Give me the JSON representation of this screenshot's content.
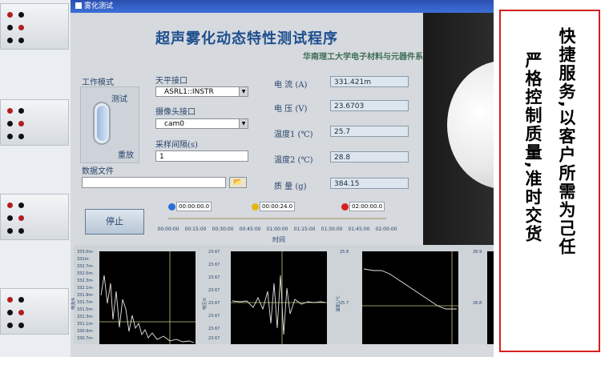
{
  "window": {
    "title": "雾化测试"
  },
  "header": {
    "title": "超声雾化动态特性测试程序",
    "subtitle": "华南理工大学电子材料与元器件系"
  },
  "mode": {
    "label": "工作模式",
    "top": "测试",
    "bottom": "重放"
  },
  "balance_port": {
    "label": "天平接口",
    "value": "ASRL1::INSTR"
  },
  "camera_port": {
    "label": "摄像头接口",
    "value": "cam0"
  },
  "sample_interval": {
    "label": "采样间隔(s)",
    "value": "1"
  },
  "data_file": {
    "label": "数据文件",
    "value": ""
  },
  "readings": [
    {
      "label": "电 流 (A)",
      "value": "331.421m"
    },
    {
      "label": "电 压 (V)",
      "value": "23.6703"
    },
    {
      "label": "温度1 (℃)",
      "value": "25.7"
    },
    {
      "label": "温度2 (℃)",
      "value": "28.8"
    },
    {
      "label": "质 量 (g)",
      "value": "384.15"
    }
  ],
  "stop_button": {
    "label": "停止"
  },
  "timeline": {
    "markers": [
      {
        "value": "00:00:00.0",
        "color": "#2c6ed6"
      },
      {
        "value": "00:00:24.0",
        "color": "#e8b415"
      },
      {
        "value": "02:00:00.0",
        "color": "#d42020"
      }
    ],
    "ticks": [
      "00:00:00",
      "00:15:00",
      "00:30:00",
      "00:45:00",
      "01:00:00",
      "01:15:00",
      "01:30:00",
      "01:45:00",
      "02:00:00"
    ],
    "axis_label": "时间"
  },
  "charts": [
    {
      "yticks": [
        "333.0m-",
        "332m-",
        "332.7m-",
        "332.5m-",
        "332.3m-",
        "332.1m-",
        "331.9m-",
        "331.7m-",
        "331.5m-",
        "331.3m-",
        "331.1m-",
        "330.9m-",
        "330.7m-"
      ],
      "ylabel": "电流/A"
    },
    {
      "yticks": [
        "23.67",
        "23.67",
        "23.67",
        "23.67",
        "23.67",
        "23.67",
        "23.67",
        "23.67"
      ],
      "ylabel": "电压/V"
    },
    {
      "yticks": [
        "25.8",
        "25.7"
      ],
      "ylabel": "温度1/℃"
    },
    {
      "yticks": [
        "28.9",
        "28.8"
      ],
      "ylabel": "温度2/℃"
    }
  ],
  "banner": {
    "col1": "快捷服务,以客户所需为己任",
    "col2": "严格控制质量,准时交货"
  }
}
